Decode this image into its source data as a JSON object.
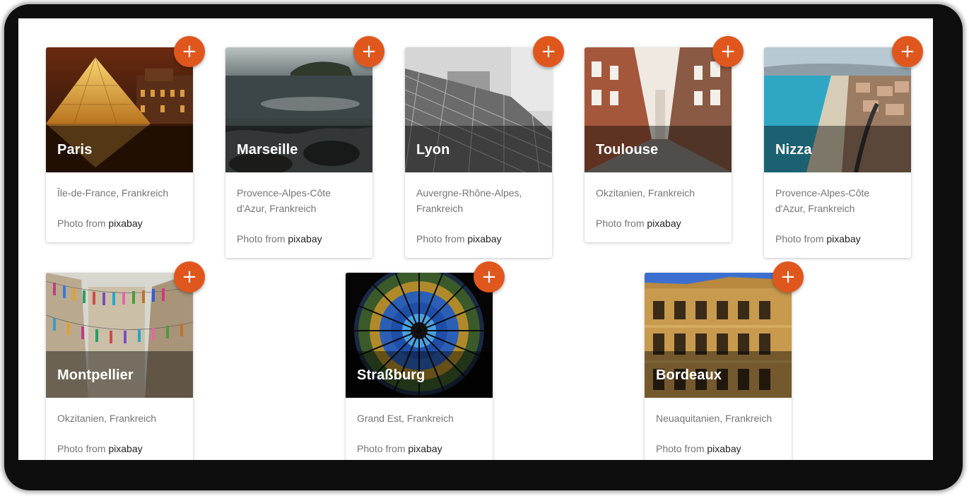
{
  "credit_prefix": "Photo from",
  "credit_source": "pixabay",
  "add_button_icon": "plus-icon",
  "accent_color": "#e0571d",
  "cities": [
    {
      "name": "Paris",
      "region": "Île-de-France, Frankreich"
    },
    {
      "name": "Marseille",
      "region": "Provence-Alpes-Côte d'Azur, Frankreich"
    },
    {
      "name": "Lyon",
      "region": "Auvergne-Rhône-Alpes, Frankreich"
    },
    {
      "name": "Toulouse",
      "region": "Okzitanien, Frankreich"
    },
    {
      "name": "Nizza",
      "region": "Provence-Alpes-Côte d'Azur, Frankreich"
    },
    {
      "name": "Montpellier",
      "region": "Okzitanien, Frankreich"
    },
    {
      "name": "Straßburg",
      "region": "Grand Est, Frankreich"
    },
    {
      "name": "Bordeaux",
      "region": "Neuaquitanien, Frankreich"
    }
  ]
}
